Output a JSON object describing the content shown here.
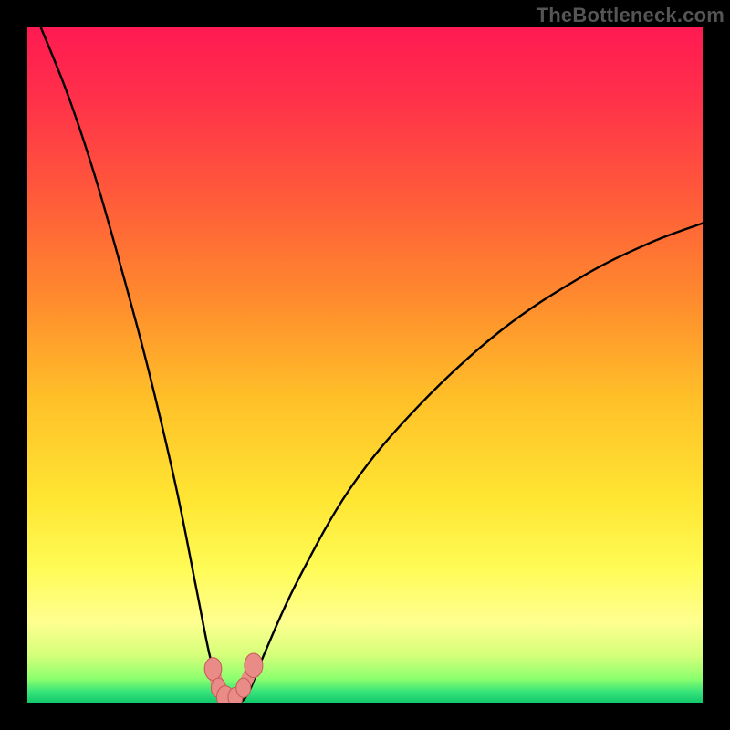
{
  "watermark": "TheBottleneck.com",
  "colors": {
    "frame": "#000000",
    "gradient_stops": [
      {
        "offset": 0.0,
        "color": "#ff1a52"
      },
      {
        "offset": 0.1,
        "color": "#ff2f4a"
      },
      {
        "offset": 0.25,
        "color": "#ff5a3a"
      },
      {
        "offset": 0.4,
        "color": "#ff8a2e"
      },
      {
        "offset": 0.55,
        "color": "#ffc028"
      },
      {
        "offset": 0.7,
        "color": "#ffe633"
      },
      {
        "offset": 0.8,
        "color": "#fffb55"
      },
      {
        "offset": 0.88,
        "color": "#ffff90"
      },
      {
        "offset": 0.93,
        "color": "#d5ff7a"
      },
      {
        "offset": 0.965,
        "color": "#8bff6e"
      },
      {
        "offset": 0.985,
        "color": "#34e27a"
      },
      {
        "offset": 1.0,
        "color": "#12c86a"
      }
    ],
    "curve": "#000000",
    "markers_fill": "#e98b86",
    "markers_stroke": "#c55a55"
  },
  "chart_data": {
    "type": "line",
    "x_range": [
      0,
      100
    ],
    "y_range_percent": [
      0,
      100
    ],
    "xlabel": "",
    "ylabel": "",
    "title": "",
    "minimum_x": 30,
    "curve_points": [
      {
        "x": 2,
        "y": 100
      },
      {
        "x": 6,
        "y": 90
      },
      {
        "x": 10,
        "y": 78
      },
      {
        "x": 14,
        "y": 64
      },
      {
        "x": 18,
        "y": 49
      },
      {
        "x": 22,
        "y": 32
      },
      {
        "x": 25,
        "y": 17
      },
      {
        "x": 27,
        "y": 7
      },
      {
        "x": 28.5,
        "y": 2
      },
      {
        "x": 30,
        "y": 0
      },
      {
        "x": 31.5,
        "y": 0
      },
      {
        "x": 33,
        "y": 2
      },
      {
        "x": 35,
        "y": 7
      },
      {
        "x": 40,
        "y": 18
      },
      {
        "x": 48,
        "y": 32
      },
      {
        "x": 58,
        "y": 44
      },
      {
        "x": 70,
        "y": 55
      },
      {
        "x": 82,
        "y": 63
      },
      {
        "x": 92,
        "y": 68
      },
      {
        "x": 100,
        "y": 71
      }
    ],
    "markers": [
      {
        "x": 27.5,
        "y": 5,
        "r": 1.4
      },
      {
        "x": 28.3,
        "y": 2.2,
        "r": 1.2
      },
      {
        "x": 29.3,
        "y": 0.8,
        "r": 1.4
      },
      {
        "x": 30.8,
        "y": 0.8,
        "r": 1.2
      },
      {
        "x": 32.0,
        "y": 2.2,
        "r": 1.2
      },
      {
        "x": 33.5,
        "y": 5.5,
        "r": 1.5
      }
    ]
  }
}
